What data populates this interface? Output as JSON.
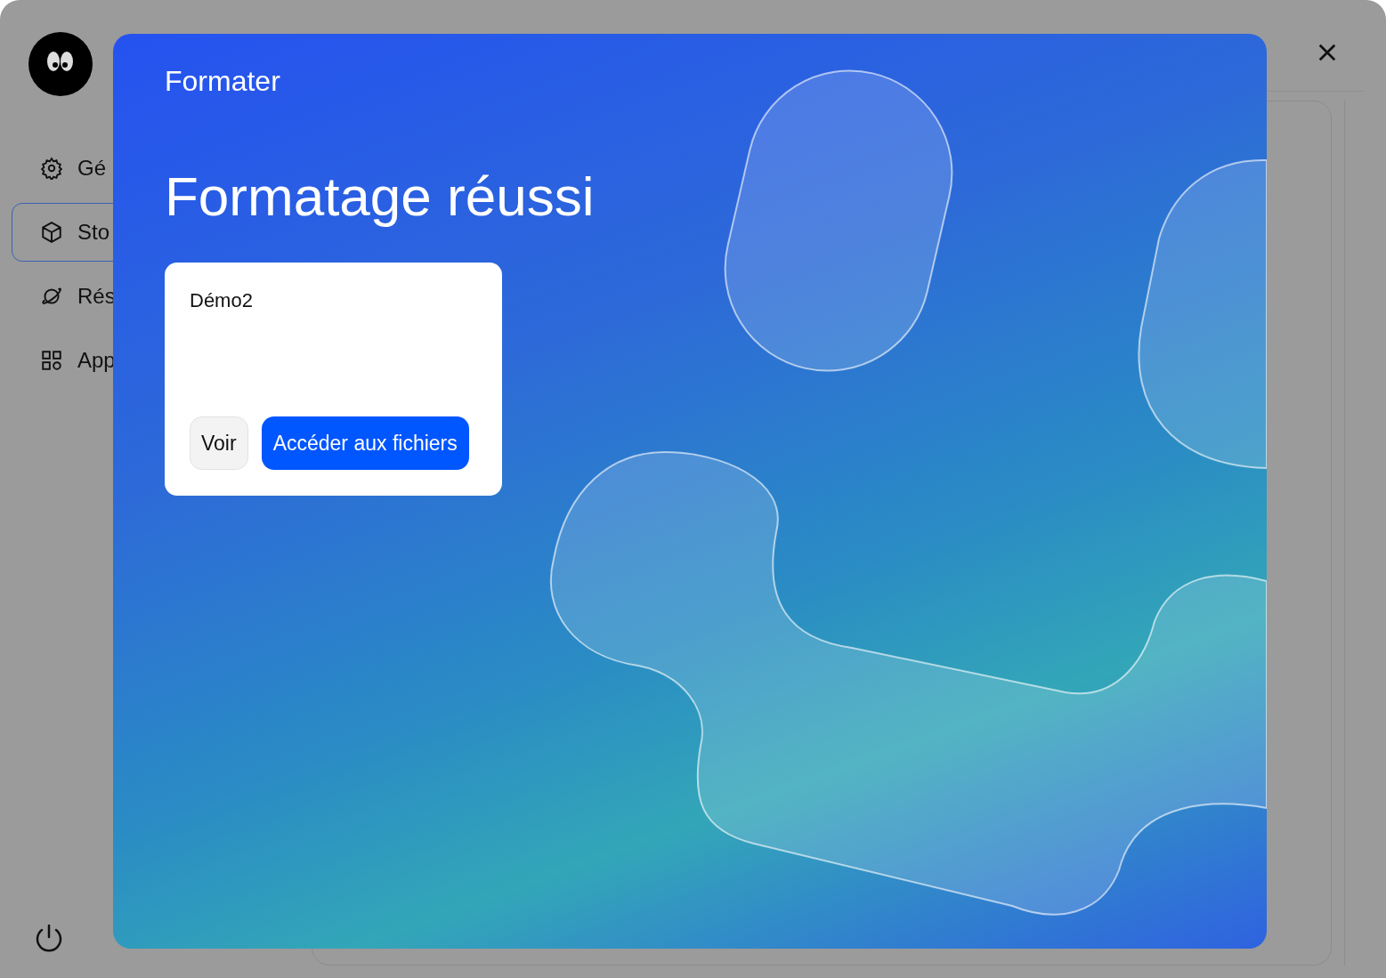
{
  "sidebar": {
    "items": [
      {
        "label": "Gé",
        "selected": false
      },
      {
        "label": "Sto",
        "selected": true
      },
      {
        "label": "Rés",
        "selected": false
      },
      {
        "label": "App",
        "selected": false
      }
    ]
  },
  "dialog": {
    "title": "Formater",
    "heading": "Formatage réussi",
    "card": {
      "name": "Démo2",
      "buttons": [
        {
          "label": "Voir",
          "kind": "secondary"
        },
        {
          "label": "Accéder aux fichiers",
          "kind": "primary"
        }
      ]
    }
  }
}
